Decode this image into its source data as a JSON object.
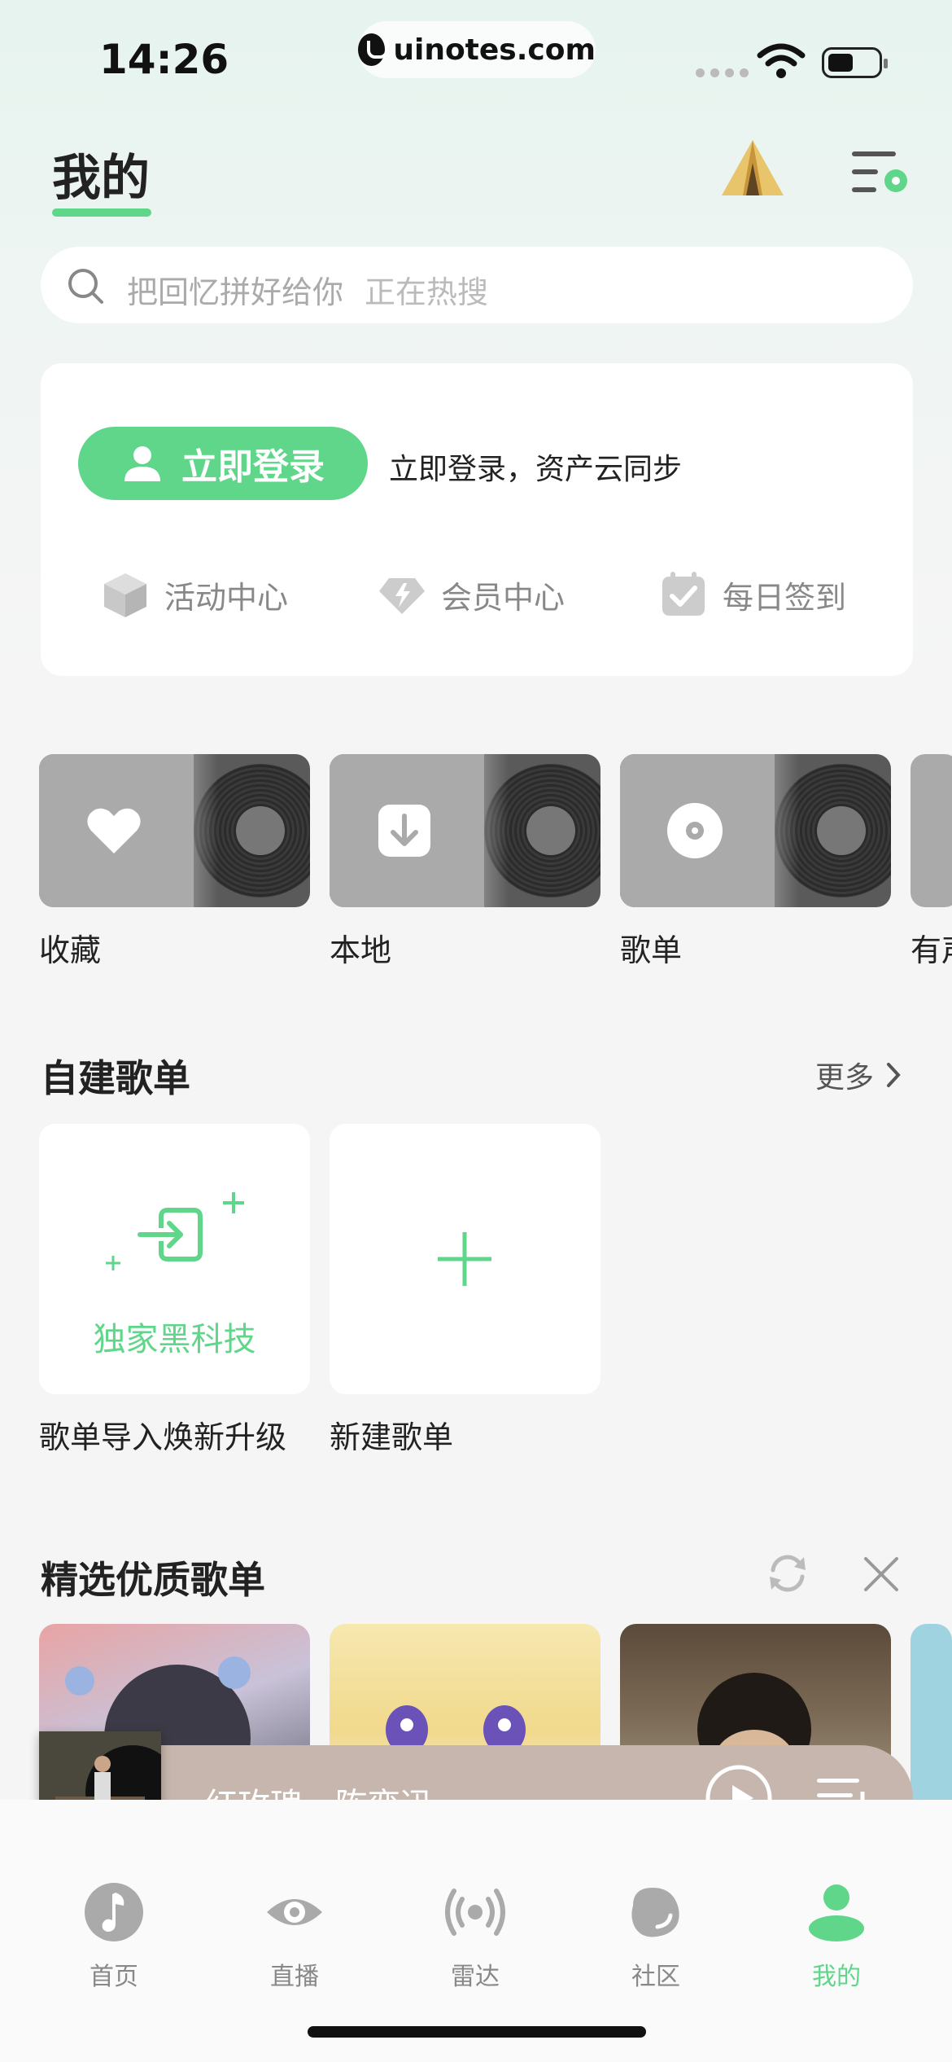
{
  "status_bar": {
    "time": "14:26",
    "url": "uinotes.com"
  },
  "header": {
    "title": "我的"
  },
  "search": {
    "placeholder": "把回忆拼好给你",
    "hot_hint": "正在热搜"
  },
  "login_card": {
    "login_button": "立即登录",
    "login_note": "立即登录，资产云同步",
    "quick_links": [
      {
        "label": "活动中心",
        "icon": "box-icon"
      },
      {
        "label": "会员中心",
        "icon": "diamond-icon"
      },
      {
        "label": "每日签到",
        "icon": "calendar-check-icon"
      }
    ]
  },
  "categories": [
    {
      "label": "收藏",
      "icon": "heart-icon"
    },
    {
      "label": "本地",
      "icon": "download-icon"
    },
    {
      "label": "歌单",
      "icon": "disc-icon"
    },
    {
      "label": "有声",
      "icon": "headphone-icon"
    }
  ],
  "custom_playlists": {
    "title": "自建歌单",
    "more": "更多",
    "items": [
      {
        "card_text": "独家黑科技",
        "label": "歌单导入焕新升级"
      },
      {
        "card_text": "",
        "label": "新建歌单"
      }
    ]
  },
  "featured": {
    "title": "精选优质歌单"
  },
  "player": {
    "song": "红玫瑰 - 陈奕迅"
  },
  "tabs": [
    {
      "label": "首页",
      "icon": "music-note-icon"
    },
    {
      "label": "直播",
      "icon": "eye-icon"
    },
    {
      "label": "雷达",
      "icon": "radar-icon"
    },
    {
      "label": "社区",
      "icon": "community-icon"
    },
    {
      "label": "我的",
      "icon": "profile-icon",
      "active": true
    }
  ],
  "colors": {
    "accent": "#5fd68a",
    "player_bg": "#c7b6ad",
    "tile_gray": "#aaaaaa"
  }
}
